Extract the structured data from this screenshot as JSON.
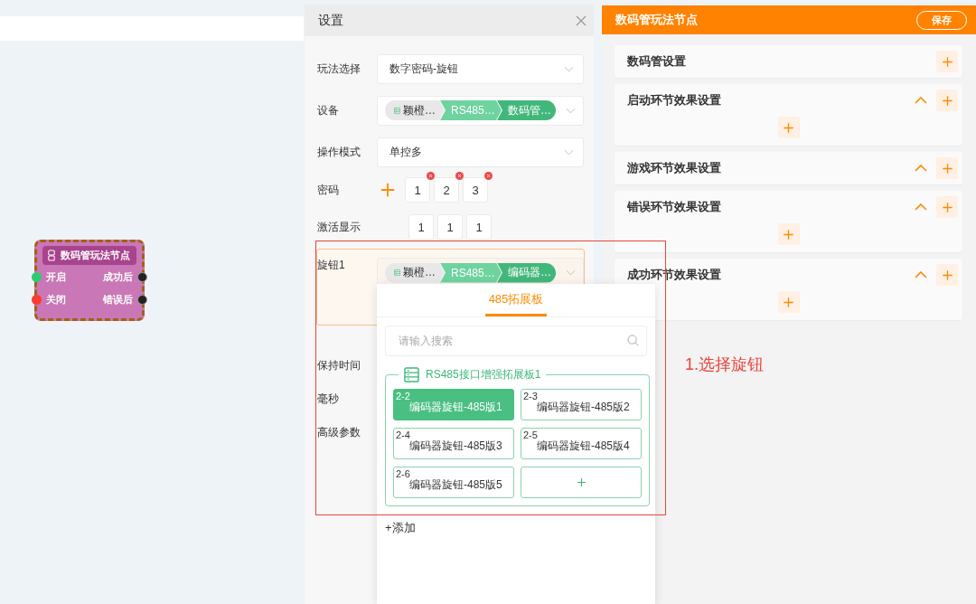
{
  "canvas": {
    "node": {
      "title": "数码管玩法节点",
      "inputs": [
        {
          "label": "开启",
          "color": "#2ecc71"
        },
        {
          "label": "关闭",
          "color": "#ff3b30"
        }
      ],
      "outputs": [
        {
          "label": "成功后"
        },
        {
          "label": "错误后"
        }
      ]
    }
  },
  "settings": {
    "title": "设置",
    "fields": [
      {
        "kind": "select",
        "label": "玩法选择",
        "value": "数字密码-旋钮",
        "active": false
      },
      {
        "kind": "chain",
        "label": "设备",
        "segments": [
          "颖橙…",
          "RS485…",
          "数码管…"
        ],
        "active": false
      },
      {
        "kind": "select",
        "label": "操作模式",
        "value": "单控多",
        "active": false
      },
      {
        "kind": "password",
        "label": "密码",
        "digits": [
          "1",
          "2",
          "3"
        ],
        "active": false
      },
      {
        "kind": "display",
        "label": "激活显示",
        "digits": [
          "1",
          "1",
          "1"
        ],
        "active": false
      },
      {
        "kind": "chain",
        "label": "旋钮1",
        "segments": [
          "颖橙…",
          "RS485…",
          "编码器…"
        ],
        "active": true
      },
      {
        "kind": "plain",
        "label": "保持时间",
        "active": false
      },
      {
        "kind": "plain",
        "label": "毫秒",
        "active": false
      },
      {
        "kind": "plain",
        "label": "高级参数",
        "active": false
      }
    ]
  },
  "popup": {
    "tab": {
      "label": "485拓展板",
      "selected": true
    },
    "search": {
      "placeholder": "请输入搜索"
    },
    "group": {
      "title": "RS485接口增强拓展板1",
      "items": [
        {
          "code": "2-2",
          "name": "编码器旋钮-485版1",
          "selected": true
        },
        {
          "code": "2-3",
          "name": "编码器旋钮-485版2",
          "selected": false
        },
        {
          "code": "2-4",
          "name": "编码器旋钮-485版3",
          "selected": false
        },
        {
          "code": "2-5",
          "name": "编码器旋钮-485版4",
          "selected": false
        },
        {
          "code": "2-6",
          "name": "编码器旋钮-485版5",
          "selected": false
        }
      ]
    },
    "add_link": "+添加"
  },
  "annotation": {
    "text": "1.选择旋钮"
  },
  "side_panel": {
    "title": "数码管玩法节点",
    "save_button": "保存",
    "sections": [
      {
        "title": "数码管设置",
        "collapsible": false,
        "content_row": false
      },
      {
        "title": "启动环节效果设置",
        "collapsible": true,
        "content_row": true
      },
      {
        "title": "游戏环节效果设置",
        "collapsible": true,
        "content_row": false
      },
      {
        "title": "错误环节效果设置",
        "collapsible": true,
        "content_row": true
      },
      {
        "title": "成功环节效果设置",
        "collapsible": true,
        "content_row": true
      }
    ]
  }
}
